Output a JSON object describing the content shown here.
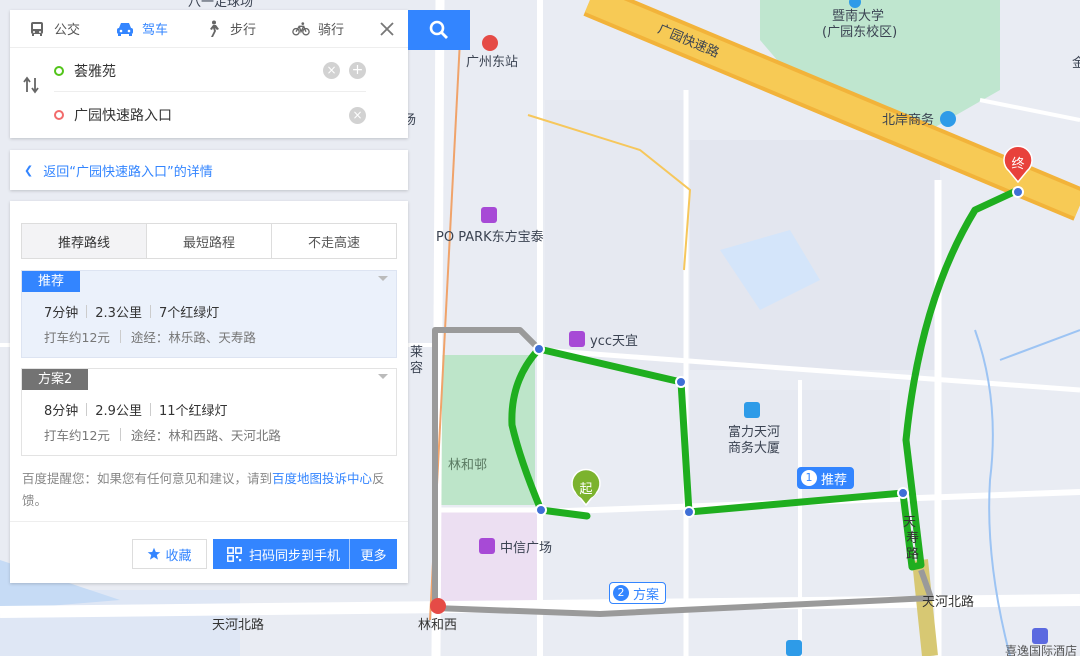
{
  "modes": [
    {
      "label": "公交",
      "icon": "bus-icon"
    },
    {
      "label": "驾车",
      "icon": "car-icon",
      "active": true
    },
    {
      "label": "步行",
      "icon": "walk-icon"
    },
    {
      "label": "骑行",
      "icon": "bike-icon"
    }
  ],
  "route": {
    "start": "荟雅苑",
    "end": "广园快速路入口"
  },
  "back_link": "返回“广园快速路入口”的详情",
  "route_tabs": [
    "推荐路线",
    "最短路程",
    "不走高速"
  ],
  "plans": [
    {
      "tag": "推荐",
      "time": "7分钟",
      "distance": "2.3公里",
      "lights": "7个红绿灯",
      "fare": "打车约12元",
      "via": "途经：林乐路、天寿路"
    },
    {
      "tag": "方案2",
      "time": "8分钟",
      "distance": "2.9公里",
      "lights": "11个红绿灯",
      "fare": "打车约12元",
      "via": "途经：林和西路、天河北路"
    }
  ],
  "feedback": {
    "prefix": "百度提醒您：如果您有任何意见和建议，请到",
    "link": "百度地图投诉中心",
    "suffix": "反馈。"
  },
  "actions": {
    "favorite": "收藏",
    "sync": "扫码同步到手机",
    "more": "更多"
  },
  "map": {
    "labels": {
      "top_cut": "八一足球场",
      "guangzhou_east": "广州东站",
      "expressway": "广园快速路",
      "jinan_univ": "暨南大学",
      "jinan_campus": "(广园东校区)",
      "beian": "北岸商务",
      "popark": "PO PARK东方宝泰",
      "ycc": "ycc天宜",
      "fuli_1": "富力天河",
      "fuli_2": "商务大厦",
      "linhe_village": "林和邨",
      "citic": "中信广场",
      "tianhe_north": "天河北路",
      "tianhe_north_2": "天河北路",
      "linhexi": "林和西",
      "tianshou_1": "天",
      "tianshou_2": "寿",
      "tianshou_3": "路",
      "lai": "莱",
      "rong": "容",
      "yang": "场",
      "right_cut": "金",
      "hotel_cut": "喜逸国际酒店"
    },
    "start_marker": "起",
    "end_marker": "终",
    "tag_recommend": {
      "num": "1",
      "text": "推荐"
    },
    "tag_plan2": {
      "num": "2",
      "text": "方案"
    }
  },
  "colors": {
    "accent": "#3385ff",
    "route_primary": "#1fae1f",
    "route_alt": "#9a9a9a",
    "end_red": "#e8413b",
    "start_green": "#7cb32e"
  }
}
